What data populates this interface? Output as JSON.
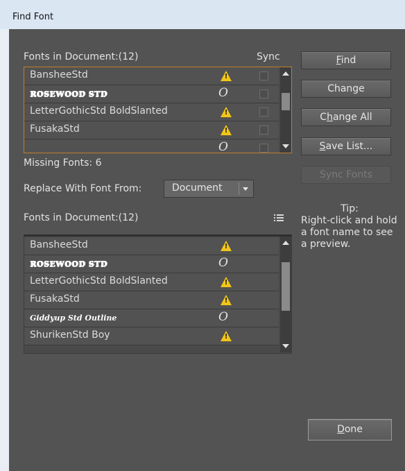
{
  "window": {
    "title": "Find Font"
  },
  "top_list": {
    "header": "Fonts in Document:(12)",
    "sync_header": "Sync",
    "rows": [
      {
        "name": "BansheeStd",
        "style": "plain",
        "icon": "warning-icon"
      },
      {
        "name": "ROSEWOOD STD",
        "style": "deco",
        "icon": "opentype-icon"
      },
      {
        "name": "LetterGothicStd BoldSlanted",
        "style": "plain",
        "icon": "warning-icon"
      },
      {
        "name": "FusakaStd",
        "style": "plain",
        "icon": "warning-icon"
      },
      {
        "name": "",
        "style": "script",
        "icon": "opentype-icon"
      }
    ]
  },
  "missing_fonts": "Missing Fonts: 6",
  "replace": {
    "label": "Replace With Font From:",
    "value": "Document"
  },
  "bottom_list": {
    "header": "Fonts in Document:(12)",
    "rows": [
      {
        "name": "BansheeStd",
        "style": "plain",
        "icon": "warning-icon"
      },
      {
        "name": "ROSEWOOD STD",
        "style": "deco",
        "icon": "opentype-icon"
      },
      {
        "name": "LetterGothicStd BoldSlanted",
        "style": "plain",
        "icon": "warning-icon"
      },
      {
        "name": "FusakaStd",
        "style": "plain",
        "icon": "warning-icon"
      },
      {
        "name": "Giddyup Std Outline",
        "style": "script",
        "icon": "opentype-icon"
      },
      {
        "name": "ShurikenStd Boy",
        "style": "plain",
        "icon": "warning-icon"
      }
    ]
  },
  "buttons": {
    "find": {
      "label": "Find",
      "mnemonic": "F",
      "rest": "ind"
    },
    "change": {
      "label": "Change"
    },
    "change_all": {
      "label": "Change All",
      "mnemonic": "h",
      "pre": "C",
      "rest": "ange All"
    },
    "save_list": {
      "label": "Save List...",
      "mnemonic": "S",
      "rest": "ave List..."
    },
    "sync_fonts": {
      "label": "Sync Fonts"
    },
    "done": {
      "label": "Done",
      "mnemonic": "D",
      "rest": "one"
    }
  },
  "tip": {
    "heading": "Tip:",
    "text": "Right-click and hold a font name to see a preview."
  }
}
